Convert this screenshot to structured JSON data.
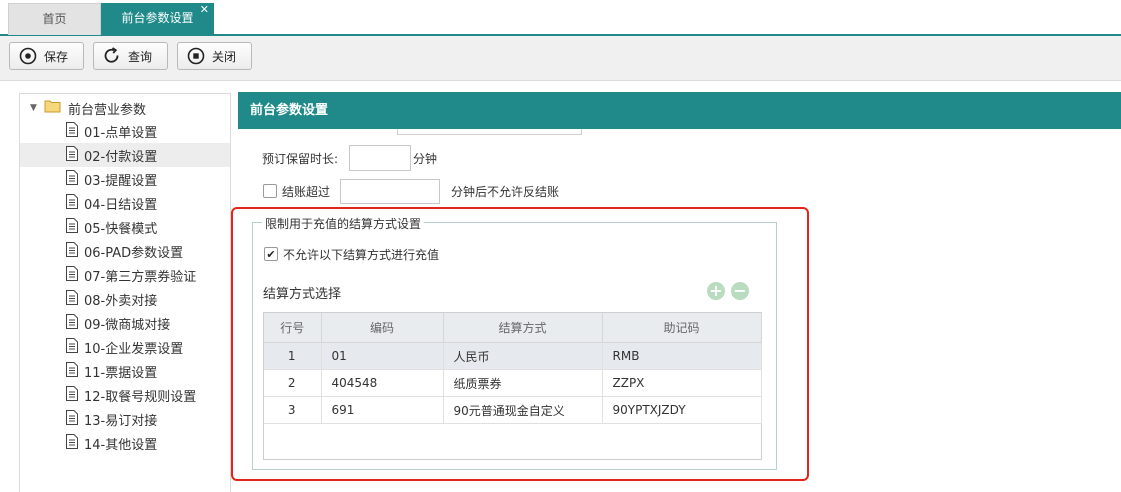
{
  "tabs": {
    "home": "首页",
    "active": "前台参数设置",
    "close": "✕"
  },
  "toolbar": {
    "save": "保存",
    "query": "查询",
    "close": "关闭"
  },
  "tree": {
    "root": "前台营业参数",
    "items": [
      "01-点单设置",
      "02-付款设置",
      "03-提醒设置",
      "04-日结设置",
      "05-快餐模式",
      "06-PAD参数设置",
      "07-第三方票券验证",
      "08-外卖对接",
      "09-微商城对接",
      "10-企业发票设置",
      "11-票据设置",
      "12-取餐号规则设置",
      "13-易订对接",
      "14-其他设置"
    ],
    "selected_index": 1
  },
  "panel": {
    "title": "前台参数设置",
    "reserve_label": "预订保留时长:",
    "reserve_value": "",
    "reserve_unit": "分钟",
    "checkout_label": "结账超过",
    "checkout_value": "",
    "checkout_suffix": "分钟后不允许反结账",
    "checkout_checked": false
  },
  "group": {
    "legend": "限制用于充值的结算方式设置",
    "restrict_label": "不允许以下结算方式进行充值",
    "restrict_checked": true,
    "checkmark": "✔",
    "select_label": "结算方式选择",
    "add": "+",
    "remove": "−"
  },
  "table": {
    "headers": [
      "行号",
      "编码",
      "结算方式",
      "助记码"
    ],
    "rows": [
      [
        "1",
        "01",
        "人民币",
        "RMB"
      ],
      [
        "2",
        "404548",
        "纸质票券",
        "ZZPX"
      ],
      [
        "3",
        "691",
        "90元普通现金自定义",
        "90YPTXJZDY"
      ]
    ],
    "selected_row": 0
  },
  "colors": {
    "accent": "#1f8a89",
    "highlight": "#e0251b",
    "add_remove": "#b9dcc0"
  },
  "icons": [
    "save-icon",
    "refresh-icon",
    "close-circle-icon",
    "folder-icon",
    "document-icon",
    "collapse-arrow-icon",
    "add-icon",
    "remove-icon"
  ]
}
